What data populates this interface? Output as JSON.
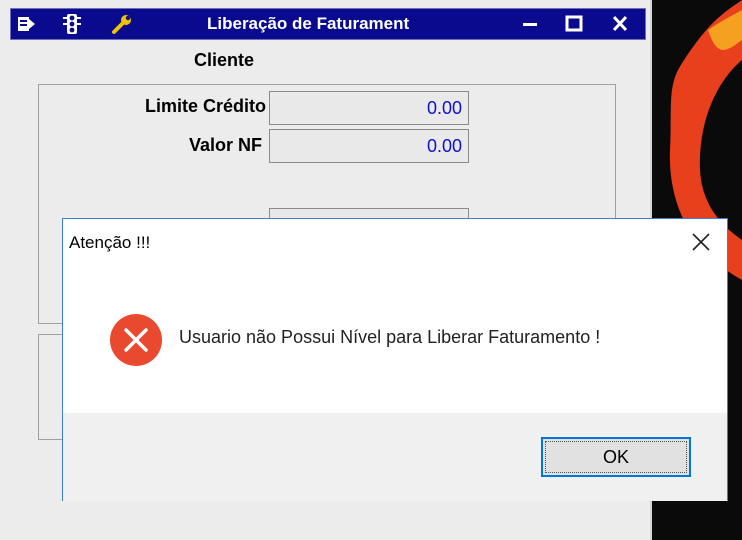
{
  "main_window": {
    "title": "Liberação de Faturament",
    "minimize_label": "–",
    "maximize_label": "□",
    "close_label": "X",
    "section_label": "Cliente",
    "fields": [
      {
        "label": "Limite Crédito",
        "value": "0.00"
      },
      {
        "label": "Valor NF",
        "value": "0.00"
      }
    ]
  },
  "dialog": {
    "title": "Atenção !!!",
    "message": "Usuario não Possui Nível para Liberar Faturamento !",
    "ok_label": "OK",
    "icon": "error-icon"
  },
  "colors": {
    "titlebar": "#0a0a8e",
    "field_value": "#1010d0",
    "error": "#e8492f",
    "focus_border": "#0078d7"
  }
}
